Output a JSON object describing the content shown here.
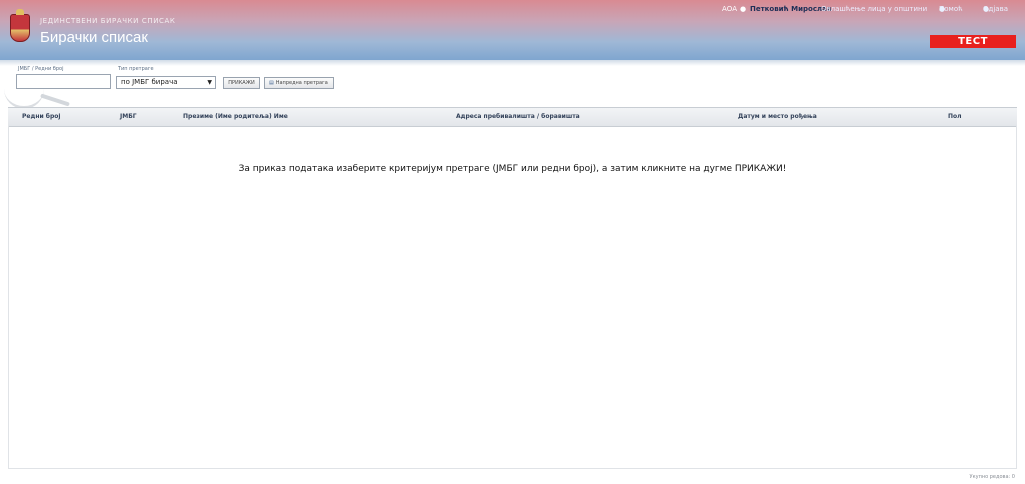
{
  "header": {
    "subtitle": "Јединствени бирачки списак",
    "title": "Бирачки списак",
    "colors": {
      "test_badge": "#e8201e"
    }
  },
  "topnav": {
    "acronym": "АОА",
    "user_icon": "user-icon",
    "user_name": "Петковић Мирослав",
    "link": "Овлашћење лица у општини",
    "help": "Помоћ",
    "logout": "Одјава"
  },
  "badge": {
    "label": "ТЕСТ"
  },
  "filter": {
    "id_label": "ЈМБГ / Редни број",
    "id_value": "",
    "type_label": "Тип претраге",
    "type_selected": "по ЈМБГ бирача",
    "show_button": "ПРИКАЖИ",
    "advanced_button": "Напредна претрага"
  },
  "table": {
    "columns": [
      "Редни број",
      "ЈМБГ",
      "Презиме (Име родитеља) Име",
      "Адреса пребивалишта / боравишта",
      "Датум и место рођења",
      "Пол"
    ],
    "empty_message": "За приказ података изаберите критеријум претраге (ЈМБГ или редни број), а затим кликните на дугме ПРИКАЖИ!"
  },
  "footer": {
    "text": "Укупно редова: 0"
  }
}
